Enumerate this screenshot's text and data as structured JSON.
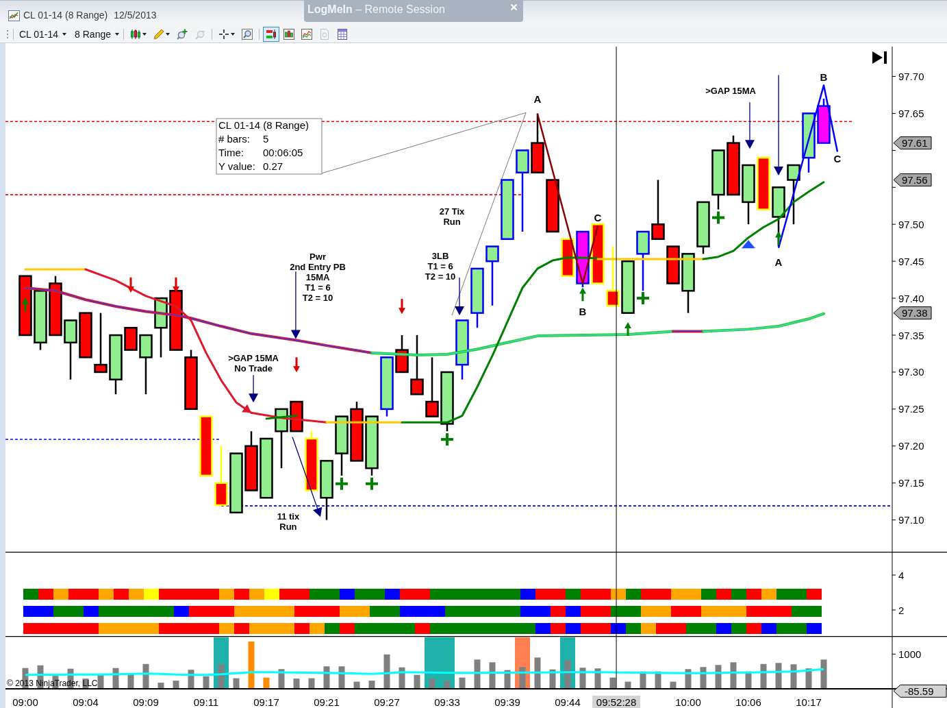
{
  "window": {
    "title": "CL 01-14 (8 Range)",
    "date": "12/5/2013"
  },
  "banner": {
    "text": "**LogMeIn** – Remote Session"
  },
  "toolbar": {
    "instrument": "CL 01-14",
    "period": "8 Range",
    "tool_groups": [
      {
        "tools": [
          {
            "kind": "candles",
            "dropdown": true,
            "selected": false,
            "disabled": false
          },
          {
            "kind": "pencil",
            "dropdown": true,
            "selected": false,
            "disabled": false
          },
          {
            "kind": "zoomin",
            "dropdown": false,
            "selected": false,
            "disabled": false
          },
          {
            "kind": "zoomout",
            "dropdown": false,
            "selected": false,
            "disabled": true
          }
        ]
      },
      {
        "tools": [
          {
            "kind": "crosshair",
            "dropdown": true,
            "selected": false,
            "disabled": false
          },
          {
            "kind": "magnifier",
            "dropdown": false,
            "selected": false,
            "disabled": false
          }
        ]
      },
      {
        "tools": [
          {
            "kind": "orders",
            "dropdown": false,
            "selected": true,
            "disabled": false
          },
          {
            "kind": "bars",
            "dropdown": false,
            "selected": false,
            "disabled": false
          },
          {
            "kind": "lines",
            "dropdown": false,
            "selected": false,
            "disabled": false
          },
          {
            "kind": "document",
            "dropdown": false,
            "selected": false,
            "disabled": true
          },
          {
            "kind": "table",
            "dropdown": false,
            "selected": false,
            "disabled": false
          }
        ]
      }
    ]
  },
  "price_panel": {
    "axis_labels": [
      "97.70",
      "97.65",
      "97.50",
      "97.45",
      "97.40",
      "97.35",
      "97.30",
      "97.25",
      "97.20",
      "97.15",
      "97.10"
    ],
    "price_tags": [
      "97.61",
      "97.56",
      "97.38"
    ],
    "measure_box": {
      "title": "CL 01-14 (8 Range)",
      "rows": [
        {
          "label": "# bars:",
          "value": "5"
        },
        {
          "label": "Time:",
          "value": "00:06:05"
        },
        {
          "label": "Y value:",
          "value": "0.27"
        }
      ]
    },
    "notes": [
      {
        "lines": [
          "Pwr",
          "2nd Entry PB",
          "15MA",
          "T1 = 6",
          "T2 = 10"
        ]
      },
      {
        "lines": [
          "27 Tix",
          "Run"
        ]
      },
      {
        "lines": [
          "3LB",
          "T1 = 6",
          "T2 = 10"
        ]
      },
      {
        "lines": [
          ">GAP 15MA",
          "No Trade"
        ]
      },
      {
        "lines": [
          "11 tix",
          "Run"
        ]
      },
      {
        "lines": [
          ">GAP 15MA"
        ]
      }
    ],
    "point_labels": [
      "A",
      "B",
      "C",
      "C",
      "A",
      "B"
    ],
    "candles": [
      {
        "color": "#ff0000",
        "kind": "plain"
      },
      {
        "color": "#90ee90",
        "kind": "plain"
      },
      {
        "color": "#ff0000",
        "kind": "plain"
      },
      {
        "color": "#90ee90",
        "kind": "plain"
      },
      {
        "color": "#ff0000",
        "kind": "plain"
      },
      {
        "color": "#ff0000",
        "kind": "plain"
      },
      {
        "color": "#90ee90",
        "kind": "plain"
      },
      {
        "color": "#ff0000",
        "kind": "plain"
      },
      {
        "color": "#90ee90",
        "kind": "plain"
      },
      {
        "color": "#90ee90",
        "kind": "plain"
      },
      {
        "color": "#ff0000",
        "kind": "plain"
      },
      {
        "color": "#ff0000",
        "kind": "plain"
      },
      {
        "color": "#ff0000",
        "kind": "yellow"
      },
      {
        "color": "#ff0000",
        "kind": "yellow"
      },
      {
        "color": "#90ee90",
        "kind": "plain"
      },
      {
        "color": "#ff0000",
        "kind": "plain"
      },
      {
        "color": "#90ee90",
        "kind": "plain"
      },
      {
        "color": "#90ee90",
        "kind": "plain"
      },
      {
        "color": "#ff0000",
        "kind": "plain"
      },
      {
        "color": "#ff0000",
        "kind": "yellow"
      },
      {
        "color": "#90ee90",
        "kind": "plain"
      },
      {
        "color": "#90ee90",
        "kind": "plain"
      },
      {
        "color": "#ff0000",
        "kind": "plain"
      },
      {
        "color": "#90ee90",
        "kind": "plain"
      },
      {
        "color": "#90ee90",
        "kind": "blue"
      },
      {
        "color": "#ff0000",
        "kind": "plain"
      },
      {
        "color": "#ff0000",
        "kind": "plain"
      },
      {
        "color": "#ff0000",
        "kind": "plain"
      },
      {
        "color": "#90ee90",
        "kind": "plain"
      },
      {
        "color": "#90ee90",
        "kind": "blue"
      },
      {
        "color": "#90ee90",
        "kind": "blue"
      },
      {
        "color": "#90ee90",
        "kind": "blue"
      },
      {
        "color": "#90ee90",
        "kind": "blue"
      },
      {
        "color": "#90ee90",
        "kind": "blue"
      },
      {
        "color": "#ff0000",
        "kind": "plain"
      },
      {
        "color": "#ff0000",
        "kind": "plain"
      },
      {
        "color": "#ff0000",
        "kind": "yellow"
      },
      {
        "color": "#ff00ff",
        "kind": "blue"
      },
      {
        "color": "#ff0000",
        "kind": "yellow"
      },
      {
        "color": "#ff0000",
        "kind": "yellow"
      },
      {
        "color": "#90ee90",
        "kind": "plain"
      },
      {
        "color": "#90ee90",
        "kind": "blue"
      },
      {
        "color": "#ff0000",
        "kind": "plain"
      },
      {
        "color": "#ff0000",
        "kind": "plain"
      },
      {
        "color": "#90ee90",
        "kind": "plain"
      },
      {
        "color": "#90ee90",
        "kind": "plain"
      },
      {
        "color": "#90ee90",
        "kind": "plain"
      },
      {
        "color": "#ff0000",
        "kind": "plain"
      },
      {
        "color": "#90ee90",
        "kind": "plain"
      },
      {
        "color": "#ff0000",
        "kind": "yellow"
      },
      {
        "color": "#90ee90",
        "kind": "plain"
      },
      {
        "color": "#90ee90",
        "kind": "plain"
      },
      {
        "color": "#90ee90",
        "kind": "blue"
      },
      {
        "color": "#ff00ff",
        "kind": "blue"
      }
    ]
  },
  "indicator_panel": {
    "yticks": [
      "4",
      "2"
    ],
    "rows": [
      {
        "blocks": [
          {
            "color": "#008000"
          },
          {
            "color": "#ff0000"
          },
          {
            "color": "#ffa500"
          },
          {
            "color": "#ff0000"
          },
          {
            "color": "#ff0000"
          },
          {
            "color": "#ffa500"
          },
          {
            "color": "#ff0000"
          },
          {
            "color": "#ffa500"
          },
          {
            "color": "#ffff00"
          },
          {
            "color": "#ff0000"
          },
          {
            "color": "#ff0000"
          },
          {
            "color": "#ff0000"
          },
          {
            "color": "#ff0000"
          },
          {
            "color": "#ffa500"
          },
          {
            "color": "#ff0000"
          },
          {
            "color": "#ffa500"
          },
          {
            "color": "#ffff00"
          },
          {
            "color": "#ff0000"
          },
          {
            "color": "#ff0000"
          },
          {
            "color": "#008000"
          },
          {
            "color": "#008000"
          },
          {
            "color": "#0000ff"
          },
          {
            "color": "#008000"
          },
          {
            "color": "#008000"
          },
          {
            "color": "#0000ff"
          },
          {
            "color": "#ff0000"
          },
          {
            "color": "#ff0000"
          },
          {
            "color": "#008000"
          },
          {
            "color": "#008000"
          },
          {
            "color": "#008000"
          },
          {
            "color": "#008000"
          },
          {
            "color": "#008000"
          },
          {
            "color": "#008000"
          },
          {
            "color": "#0000ff"
          },
          {
            "color": "#ff0000"
          },
          {
            "color": "#ff0000"
          },
          {
            "color": "#008000"
          },
          {
            "color": "#ff0000"
          },
          {
            "color": "#ff0000"
          },
          {
            "color": "#ffa500"
          },
          {
            "color": "#008000"
          },
          {
            "color": "#ff0000"
          },
          {
            "color": "#ff0000"
          },
          {
            "color": "#ffa500"
          },
          {
            "color": "#ffa500"
          },
          {
            "color": "#008000"
          },
          {
            "color": "#ff0000"
          },
          {
            "color": "#008000"
          },
          {
            "color": "#ff0000"
          },
          {
            "color": "#ffa500"
          },
          {
            "color": "#008000"
          },
          {
            "color": "#008000"
          },
          {
            "color": "#ff0000"
          }
        ]
      },
      {
        "blocks": [
          {
            "color": "#0000ff"
          },
          {
            "color": "#0000ff"
          },
          {
            "color": "#008000"
          },
          {
            "color": "#008000"
          },
          {
            "color": "#0000ff"
          },
          {
            "color": "#008000"
          },
          {
            "color": "#008000"
          },
          {
            "color": "#008000"
          },
          {
            "color": "#008000"
          },
          {
            "color": "#008000"
          },
          {
            "color": "#0000ff"
          },
          {
            "color": "#ff0000"
          },
          {
            "color": "#ff0000"
          },
          {
            "color": "#ff0000"
          },
          {
            "color": "#ffa500"
          },
          {
            "color": "#ffa500"
          },
          {
            "color": "#ffa500"
          },
          {
            "color": "#ffa500"
          },
          {
            "color": "#ff0000"
          },
          {
            "color": "#ff0000"
          },
          {
            "color": "#ff0000"
          },
          {
            "color": "#ffa500"
          },
          {
            "color": "#ffa500"
          },
          {
            "color": "#008000"
          },
          {
            "color": "#008000"
          },
          {
            "color": "#0000ff"
          },
          {
            "color": "#0000ff"
          },
          {
            "color": "#0000ff"
          },
          {
            "color": "#008000"
          },
          {
            "color": "#008000"
          },
          {
            "color": "#008000"
          },
          {
            "color": "#008000"
          },
          {
            "color": "#008000"
          },
          {
            "color": "#0000ff"
          },
          {
            "color": "#0000ff"
          },
          {
            "color": "#ff0000"
          },
          {
            "color": "#0000ff"
          },
          {
            "color": "#ff0000"
          },
          {
            "color": "#ff0000"
          },
          {
            "color": "#008000"
          },
          {
            "color": "#008000"
          },
          {
            "color": "#ffa500"
          },
          {
            "color": "#ffa500"
          },
          {
            "color": "#ff0000"
          },
          {
            "color": "#ff0000"
          },
          {
            "color": "#ffa500"
          },
          {
            "color": "#ffa500"
          },
          {
            "color": "#ffa500"
          },
          {
            "color": "#ff0000"
          },
          {
            "color": "#ff0000"
          },
          {
            "color": "#ff0000"
          },
          {
            "color": "#008000"
          },
          {
            "color": "#008000"
          }
        ]
      },
      {
        "blocks": [
          {
            "color": "#ff0000"
          },
          {
            "color": "#ff0000"
          },
          {
            "color": "#ff0000"
          },
          {
            "color": "#ff0000"
          },
          {
            "color": "#ff0000"
          },
          {
            "color": "#ffa500"
          },
          {
            "color": "#ffa500"
          },
          {
            "color": "#ffa500"
          },
          {
            "color": "#ffa500"
          },
          {
            "color": "#ff0000"
          },
          {
            "color": "#ff0000"
          },
          {
            "color": "#ff0000"
          },
          {
            "color": "#ff0000"
          },
          {
            "color": "#ffa500"
          },
          {
            "color": "#ff0000"
          },
          {
            "color": "#ffa500"
          },
          {
            "color": "#ffa500"
          },
          {
            "color": "#ffa500"
          },
          {
            "color": "#ff0000"
          },
          {
            "color": "#ffa500"
          },
          {
            "color": "#008000"
          },
          {
            "color": "#ff0000"
          },
          {
            "color": "#008000"
          },
          {
            "color": "#008000"
          },
          {
            "color": "#008000"
          },
          {
            "color": "#008000"
          },
          {
            "color": "#ff0000"
          },
          {
            "color": "#008000"
          },
          {
            "color": "#008000"
          },
          {
            "color": "#008000"
          },
          {
            "color": "#008000"
          },
          {
            "color": "#008000"
          },
          {
            "color": "#008000"
          },
          {
            "color": "#008000"
          },
          {
            "color": "#0000ff"
          },
          {
            "color": "#ff0000"
          },
          {
            "color": "#0000ff"
          },
          {
            "color": "#ff0000"
          },
          {
            "color": "#ff0000"
          },
          {
            "color": "#0000ff"
          },
          {
            "color": "#008000"
          },
          {
            "color": "#ffa500"
          },
          {
            "color": "#ff0000"
          },
          {
            "color": "#ff0000"
          },
          {
            "color": "#008000"
          },
          {
            "color": "#008000"
          },
          {
            "color": "#0000ff"
          },
          {
            "color": "#008000"
          },
          {
            "color": "#ff0000"
          },
          {
            "color": "#0000ff"
          },
          {
            "color": "#008000"
          },
          {
            "color": "#008000"
          },
          {
            "color": "#0000ff"
          }
        ]
      }
    ]
  },
  "volume_panel": {
    "axis_label": "1000",
    "value_tag": "-85.59",
    "bars": [
      {
        "color": "#808080"
      },
      {
        "color": "#808080"
      },
      {
        "color": "#808080"
      },
      {
        "color": "#808080"
      },
      {
        "color": "#808080"
      },
      {
        "color": "#808080"
      },
      {
        "color": "#808080"
      },
      {
        "color": "#808080"
      },
      {
        "color": "#808080"
      },
      {
        "color": "#808080"
      },
      {
        "color": "#808080"
      },
      {
        "color": "#808080"
      },
      {
        "color": "#808080"
      },
      {
        "color": "#808080"
      },
      {
        "color": "#808080"
      },
      {
        "color": "#ff8c00"
      },
      {
        "color": "#ff8c00"
      },
      {
        "color": "#808080"
      },
      {
        "color": "#808080"
      },
      {
        "color": "#808080"
      },
      {
        "color": "#808080"
      },
      {
        "color": "#808080"
      },
      {
        "color": "#808080"
      },
      {
        "color": "#808080"
      },
      {
        "color": "#808080"
      },
      {
        "color": "#808080"
      },
      {
        "color": "#808080"
      },
      {
        "color": "#808080"
      },
      {
        "color": "#808080"
      },
      {
        "color": "#808080"
      },
      {
        "color": "#808080"
      },
      {
        "color": "#808080"
      },
      {
        "color": "#808080"
      },
      {
        "color": "#808080"
      },
      {
        "color": "#808080"
      },
      {
        "color": "#808080"
      },
      {
        "color": "#808080"
      },
      {
        "color": "#808080"
      },
      {
        "color": "#808080"
      },
      {
        "color": "#808080"
      },
      {
        "color": "#808080"
      },
      {
        "color": "#808080"
      },
      {
        "color": "#808080"
      },
      {
        "color": "#808080"
      },
      {
        "color": "#808080"
      },
      {
        "color": "#808080"
      },
      {
        "color": "#808080"
      },
      {
        "color": "#808080"
      },
      {
        "color": "#808080"
      },
      {
        "color": "#808080"
      },
      {
        "color": "#808080"
      },
      {
        "color": "#808080"
      },
      {
        "color": "#808080"
      },
      {
        "color": "#808080"
      }
    ],
    "highlights": [
      {
        "color": "#20b2aa"
      },
      {
        "color": "#20b2aa"
      },
      {
        "color": "#20b2aa"
      },
      {
        "color": "#ff7f50"
      },
      {
        "color": "#20b2aa"
      }
    ],
    "time_labels": [
      "09:00",
      "09:04",
      "09:09",
      "09:11",
      "09:17",
      "09:21",
      "09:27",
      "09:33",
      "09:39",
      "09:44",
      "10:00",
      "10:06",
      "10:17"
    ],
    "cursor_label": "09:52:28",
    "copyright": "© 2013 NinjaTrader, LLC"
  }
}
